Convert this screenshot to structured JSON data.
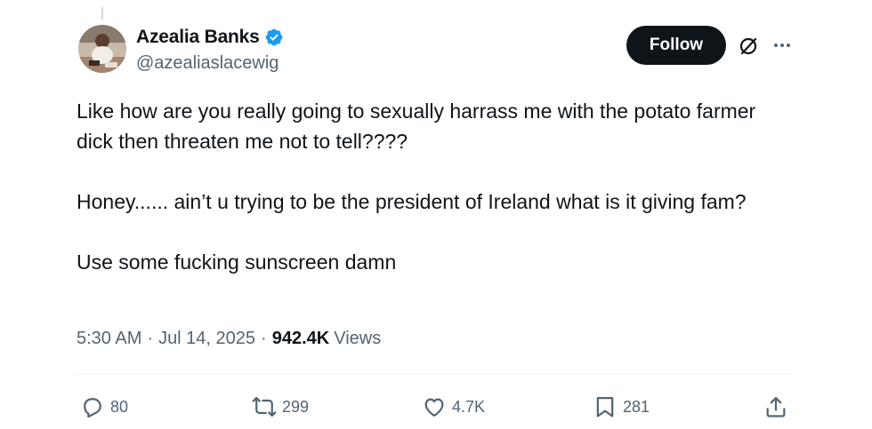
{
  "author": {
    "display_name": "Azealia Banks",
    "handle": "@azealiaslacewig",
    "verified": true,
    "avatar_icon": "profile-photo"
  },
  "header": {
    "follow_label": "Follow",
    "grok_icon": "grok-icon",
    "more_icon": "more-icon"
  },
  "tweet": {
    "paragraphs": [
      "Like how are you really going to sexually harrass me with the potato farmer dick then threaten me not to tell????",
      "Honey...... ain’t u trying to be the president of Ireland what is it giving fam?",
      "Use some fucking sunscreen damn"
    ],
    "time": "5:30 AM",
    "date": "Jul 14, 2025",
    "views_count": "942.4K",
    "views_label": "Views"
  },
  "actions": {
    "replies": "80",
    "reposts": "299",
    "likes": "4.7K",
    "bookmarks": "281"
  },
  "colors": {
    "text": "#0f1419",
    "secondary": "#536471",
    "verified_blue": "#1d9bf0",
    "follow_bg": "#0f1419"
  }
}
